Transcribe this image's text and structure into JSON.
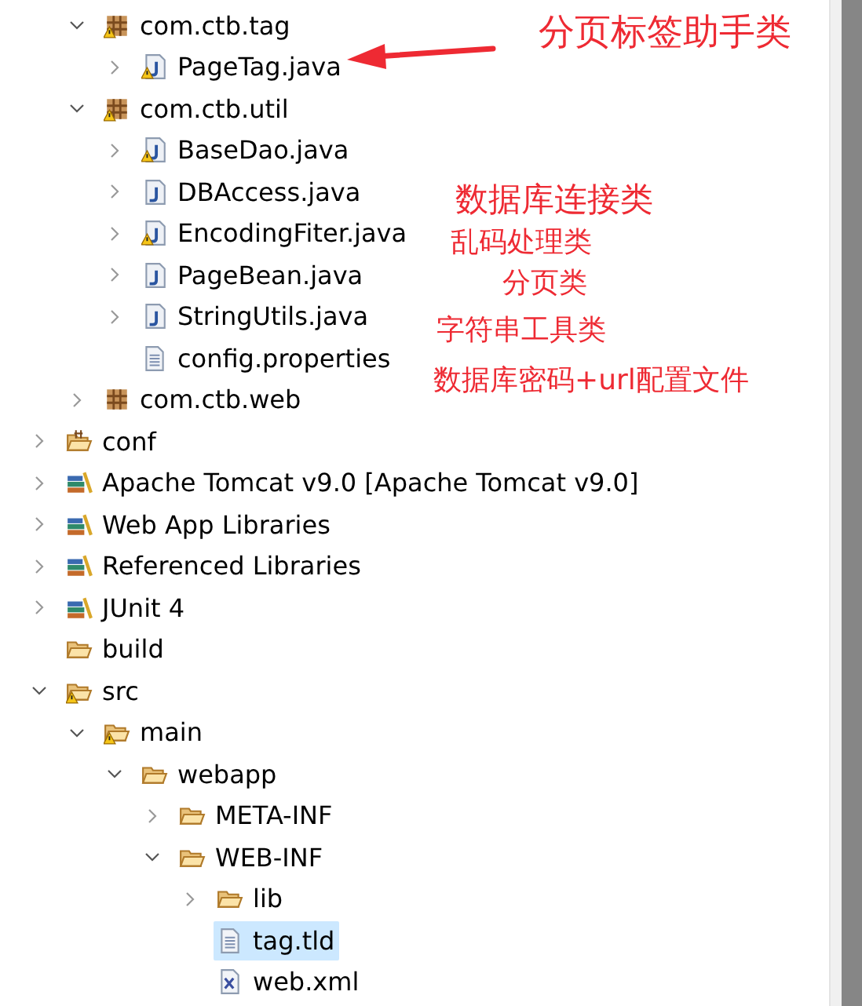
{
  "java_sources": [
    {
      "label": "com.ctb.tag",
      "kind": "package",
      "warning": true,
      "expanded": true,
      "selected": false,
      "children": [
        {
          "label": "PageTag.java",
          "kind": "java",
          "warning": true,
          "expanded": false,
          "selected": false
        }
      ]
    },
    {
      "label": "com.ctb.util",
      "kind": "package",
      "warning": true,
      "expanded": true,
      "selected": false,
      "children": [
        {
          "label": "BaseDao.java",
          "kind": "java",
          "warning": true,
          "expanded": false,
          "selected": false
        },
        {
          "label": "DBAccess.java",
          "kind": "java",
          "warning": false,
          "expanded": false,
          "selected": false
        },
        {
          "label": "EncodingFiter.java",
          "kind": "java",
          "warning": true,
          "expanded": false,
          "selected": false
        },
        {
          "label": "PageBean.java",
          "kind": "java",
          "warning": false,
          "expanded": false,
          "selected": false
        },
        {
          "label": "StringUtils.java",
          "kind": "java",
          "warning": false,
          "expanded": false,
          "selected": false
        },
        {
          "label": "config.properties",
          "kind": "file",
          "warning": false,
          "selected": false
        }
      ]
    },
    {
      "label": "com.ctb.web",
      "kind": "package",
      "warning": false,
      "expanded": false,
      "selected": false
    }
  ],
  "project_items": [
    {
      "label": "conf",
      "kind": "source-folder",
      "warning": false,
      "expanded": false,
      "selected": false
    },
    {
      "label": "Apache Tomcat v9.0 [Apache Tomcat v9.0]",
      "kind": "library",
      "warning": false,
      "expanded": false,
      "selected": false
    },
    {
      "label": "Web App Libraries",
      "kind": "library",
      "warning": false,
      "expanded": false,
      "selected": false
    },
    {
      "label": "Referenced Libraries",
      "kind": "library",
      "warning": false,
      "expanded": false,
      "selected": false
    },
    {
      "label": "JUnit 4",
      "kind": "library",
      "warning": false,
      "expanded": false,
      "selected": false
    },
    {
      "label": "build",
      "kind": "folder",
      "warning": false,
      "selected": false
    },
    {
      "label": "src",
      "kind": "folder",
      "warning": true,
      "expanded": true,
      "selected": false,
      "children": [
        {
          "label": "main",
          "kind": "folder",
          "warning": true,
          "expanded": true,
          "selected": false,
          "children": [
            {
              "label": "webapp",
              "kind": "folder",
              "warning": false,
              "expanded": true,
              "selected": false,
              "children": [
                {
                  "label": "META-INF",
                  "kind": "folder",
                  "warning": false,
                  "expanded": false,
                  "selected": false
                },
                {
                  "label": "WEB-INF",
                  "kind": "folder",
                  "warning": false,
                  "expanded": true,
                  "selected": false,
                  "children": [
                    {
                      "label": "lib",
                      "kind": "folder",
                      "warning": false,
                      "expanded": false,
                      "selected": false
                    },
                    {
                      "label": "tag.tld",
                      "kind": "file",
                      "warning": false,
                      "selected": true
                    },
                    {
                      "label": "web.xml",
                      "kind": "xml",
                      "warning": false,
                      "selected": false
                    }
                  ]
                }
              ]
            }
          ]
        }
      ]
    }
  ],
  "annotations": [
    {
      "text": "分页标签助手类",
      "kind": "arrow-note"
    },
    {
      "text": "数据库连接类",
      "kind": "note"
    },
    {
      "text": "乱码处理类",
      "kind": "note"
    },
    {
      "text": "分页类",
      "kind": "note"
    },
    {
      "text": "字符串工具类",
      "kind": "note"
    },
    {
      "text": "数据库密码+url配置文件",
      "kind": "note"
    }
  ]
}
